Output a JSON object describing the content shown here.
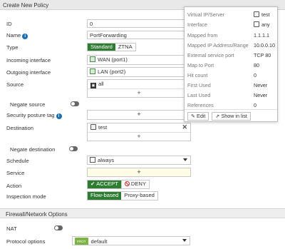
{
  "header": {
    "title": "Create New Policy"
  },
  "form": {
    "id_label": "ID",
    "id_value": "0",
    "name_label": "Name",
    "name_value": "PortForwarding",
    "type_label": "Type",
    "type_options": [
      "Standard",
      "ZTNA"
    ],
    "incoming_label": "Incoming interface",
    "incoming_value": "WAN (port1)",
    "outgoing_label": "Outgoing interface",
    "outgoing_value": "LAN (port2)",
    "source_label": "Source",
    "source_value": "all",
    "negate_source_label": "Negate source",
    "posture_label": "Security posture tag",
    "destination_label": "Destination",
    "destination_value": "test",
    "negate_dest_label": "Negate destination",
    "schedule_label": "Schedule",
    "schedule_value": "always",
    "service_label": "Service",
    "action_label": "Action",
    "action_accept": "ACCEPT",
    "action_deny": "DENY",
    "inspection_label": "Inspection mode",
    "inspection_options": [
      "Flow-based",
      "Proxy-based"
    ],
    "add_symbol": "+",
    "remove_symbol": "✕"
  },
  "section2": {
    "title": "Firewall/Network Options",
    "nat_label": "NAT",
    "protocol_label": "Protocol options",
    "protocol_badge": "PROT",
    "protocol_value": "default"
  },
  "tooltip": {
    "rows": [
      {
        "label": "Virtual IP/Server",
        "value": "test"
      },
      {
        "label": "Interface",
        "value": "any"
      },
      {
        "label": "Mapped from",
        "value": "1.1.1.1"
      },
      {
        "label": "Mapped IP Address/Range",
        "value": "10.0.0.10"
      },
      {
        "label": "External service port",
        "value": "TCP 80"
      },
      {
        "label": "Map to Port",
        "value": "80"
      },
      {
        "label": "Hit count",
        "value": "0"
      },
      {
        "label": "First Used",
        "value": "Never"
      },
      {
        "label": "Last Used",
        "value": "Never"
      },
      {
        "label": "References",
        "value": "0"
      }
    ],
    "edit_label": "Edit",
    "show_label": "Show in list"
  },
  "colors": {
    "accent_green": "#2e7d32",
    "info_blue": "#1a6fb3",
    "deny_red": "#c62828"
  }
}
